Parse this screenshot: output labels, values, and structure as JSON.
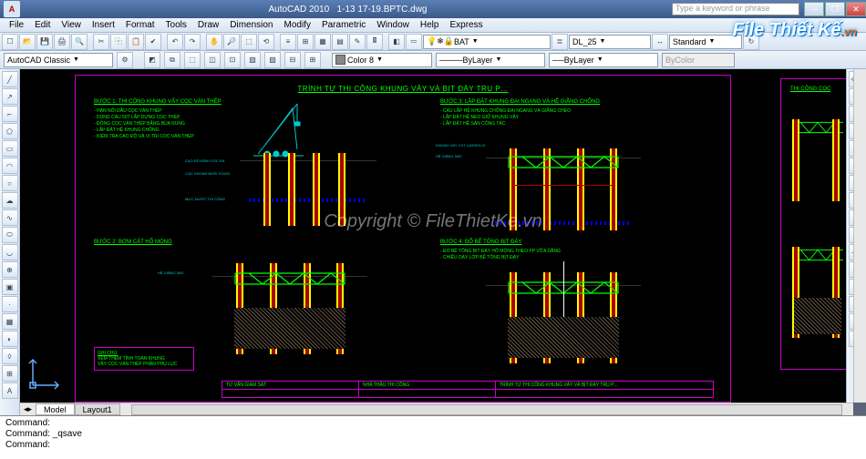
{
  "app": {
    "name": "AutoCAD 2010",
    "file": "1-13 17-19.BPTC.dwg",
    "logo": "A"
  },
  "search": {
    "placeholder": "Type a keyword or phrase"
  },
  "menu": [
    "File",
    "Edit",
    "View",
    "Insert",
    "Format",
    "Tools",
    "Draw",
    "Dimension",
    "Modify",
    "Parametric",
    "Window",
    "Help",
    "Express"
  ],
  "props": {
    "workspace": "AutoCAD Classic",
    "layer_drop": "BAT",
    "lt_drop": "DL_25",
    "style": "Standard",
    "color": "Color 8",
    "ltype": "ByLayer",
    "lweight": "ByLayer",
    "pstyle": "ByColor"
  },
  "tabs": {
    "model": "Model",
    "layout": "Layout1"
  },
  "cmd": {
    "l1": "Command: _qsave",
    "l2": "Command:",
    "l3": "Command:"
  },
  "drawing": {
    "title": "TRÌNH TỰ THI CÔNG KHUNG VÂY VÀ BỊT ĐÁY TRỤ P…",
    "s1h": "BƯỚC 1: THI CÔNG KHUNG VÂY CỌC VÁN THÉP",
    "s1t": "- HÀN NỐI ĐẦU CỌC VÁN THÉP\n- DÙNG CẨU 50T LẮP DỰNG CỌC THÉP\n- ĐÓNG CỌC VÁN THÉP BẰNG BÚA RUNG\n- LẮP ĐẶT HỆ KHUNG CHỐNG\n- KIỂM TRA CAO ĐỘ VÀ VỊ TRÍ CỌC VÁN THÉP",
    "s2h": "BƯỚC 2: BƠM CÁT HỐ MÓNG",
    "s3h": "BƯỚC 3: LẮP ĐẶT KHUNG ĐAI NGANG VÀ HỆ GIẰNG CHỐNG",
    "s3t": "- CẨU LẮP HỆ KHUNG CHỐNG ĐAI NGANG VÀ GIẰNG CHÉO\n- LẮP ĐẶT HỆ NEO GIỮ KHUNG VÂY\n- LẮP ĐẶT HỆ SÀN CÔNG TÁC",
    "s4h": "BƯỚC 4: ĐỔ BÊ TÔNG BỊT ĐÁY",
    "s4t": "- ĐỔ BÊ TÔNG BỊT ĐÁY HỐ MÓNG THEO PP VỮA DÂNG\n- CHIỀU DÀY LỚP BÊ TÔNG BỊT ĐÁY",
    "note_h": "GHI CHÚ:",
    "note_t": "XEM THÊM TÍNH TOÁN KHUNG\nVÂY CỌC VÁN THÉP PHẦN PHỤ LỤC",
    "tb": {
      "c1": "TƯ VẤN GIÁM SÁT",
      "c2": "NHÀ THẦU THI CÔNG",
      "c3": "TRÌNH TỰ THI CÔNG KHUNG VÂY VÀ BỊT ĐÁY TRỤ P…"
    },
    "lbl": {
      "ground": "CAO ĐỘ ĐỈNH CỌC KN",
      "pile": "CỌC KHOAN NHỒI ∅1000",
      "water": "MỰC NƯỚC THI CÔNG",
      "truss": "HỆ GIẰNG I400",
      "top": "KHUNG VÂY CVT LARSEN IV"
    },
    "side_title": "THI CÔNG CỌC"
  },
  "brand": {
    "t": "File Thiết Kế",
    "ext": ".vn"
  },
  "wm": "Copyright © FileThietKe.vn"
}
